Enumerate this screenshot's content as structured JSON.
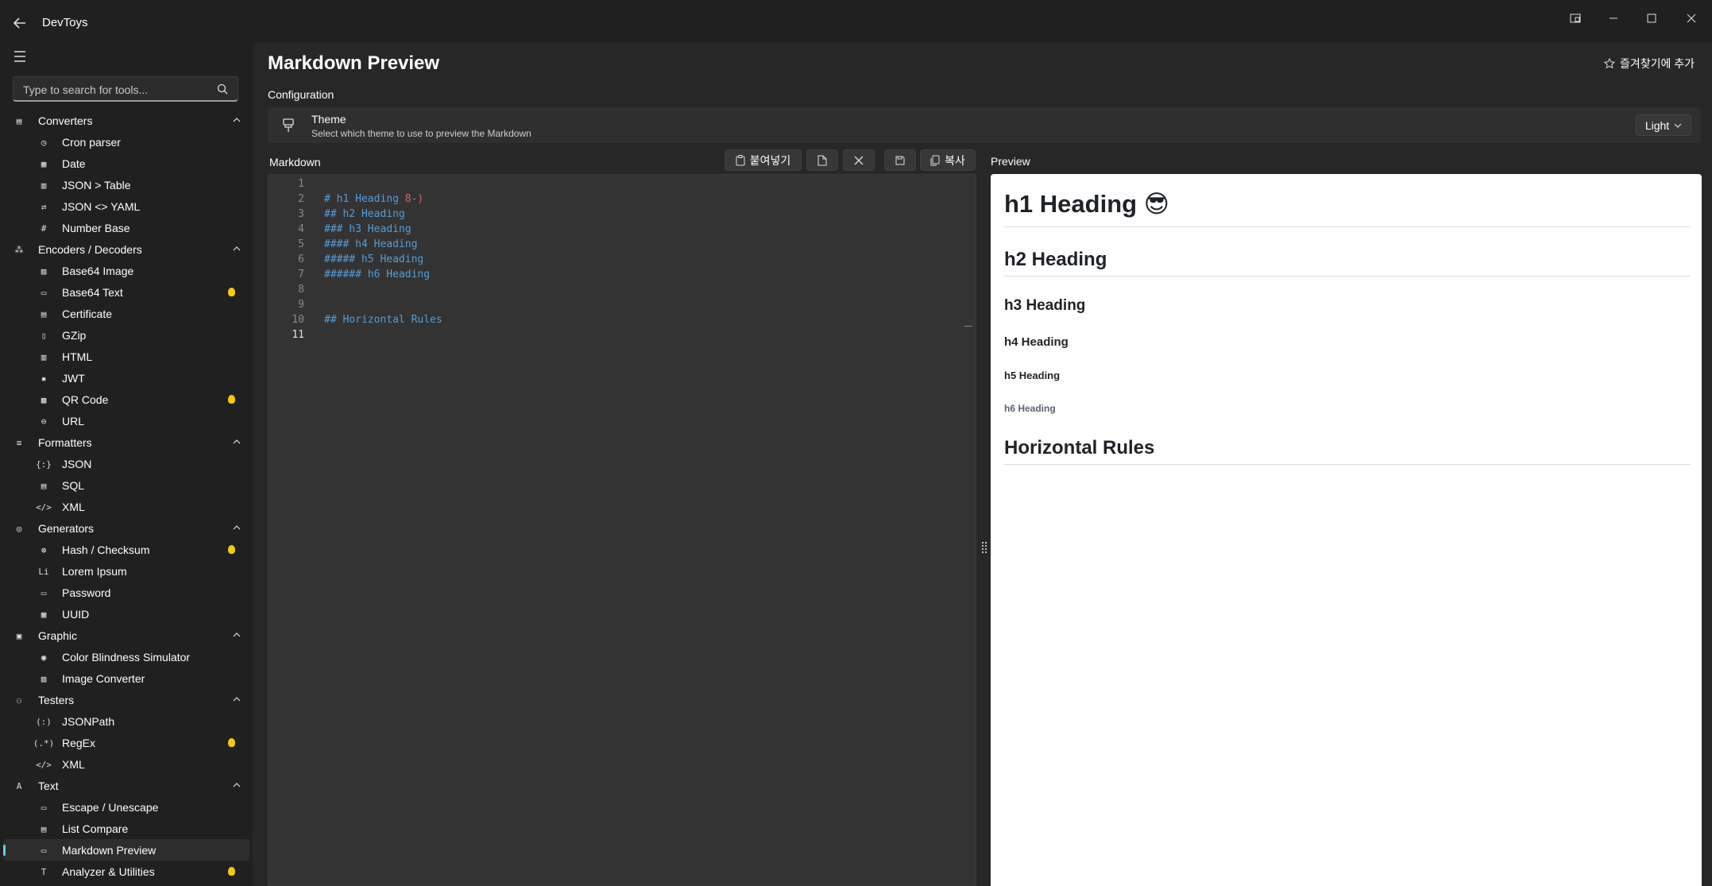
{
  "app": {
    "title": "DevToys"
  },
  "search": {
    "placeholder": "Type to search for tools..."
  },
  "sidebar": {
    "groups": [
      {
        "label": "Converters",
        "items": [
          "Cron parser",
          "Date",
          "JSON > Table",
          "JSON <> YAML",
          "Number Base"
        ]
      },
      {
        "label": "Encoders / Decoders",
        "items": [
          "Base64 Image",
          "Base64 Text",
          "Certificate",
          "GZip",
          "HTML",
          "JWT",
          "QR Code",
          "URL"
        ]
      },
      {
        "label": "Formatters",
        "items": [
          "JSON",
          "SQL",
          "XML"
        ]
      },
      {
        "label": "Generators",
        "items": [
          "Hash / Checksum",
          "Lorem Ipsum",
          "Password",
          "UUID"
        ]
      },
      {
        "label": "Graphic",
        "items": [
          "Color Blindness Simulator",
          "Image Converter"
        ]
      },
      {
        "label": "Testers",
        "items": [
          "JSONPath",
          "RegEx",
          "XML"
        ]
      },
      {
        "label": "Text",
        "items": [
          "Escape / Unescape",
          "List Compare",
          "Markdown Preview",
          "Analyzer & Utilities"
        ]
      }
    ],
    "bulb_icons": [
      "Base64 Text",
      "QR Code",
      "Hash / Checksum",
      "RegEx",
      "Analyzer & Utilities"
    ],
    "selected": "Markdown Preview"
  },
  "page": {
    "title": "Markdown Preview",
    "favorite_label": "즐겨찾기에 추가",
    "configuration_label": "Configuration"
  },
  "theme": {
    "title": "Theme",
    "subtitle": "Select which theme to use to preview the Markdown",
    "value": "Light"
  },
  "markdown": {
    "label": "Markdown",
    "paste_label": "붙여넣기",
    "copy_label": "복사",
    "lines": [
      "",
      "# h1 Heading 8-)",
      "## h2 Heading",
      "### h3 Heading",
      "#### h4 Heading",
      "##### h5 Heading",
      "###### h6 Heading",
      "",
      "",
      "## Horizontal Rules",
      ""
    ],
    "line_numbers": [
      "1",
      "2",
      "3",
      "4",
      "5",
      "6",
      "7",
      "8",
      "9",
      "10",
      "11"
    ],
    "current_line": 11
  },
  "preview": {
    "label": "Preview",
    "h1": "h1 Heading",
    "h1_emoji": "😎",
    "h2": "h2 Heading",
    "h3": "h3 Heading",
    "h4": "h4 Heading",
    "h5": "h5 Heading",
    "h6": "h6 Heading",
    "h2b": "Horizontal Rules"
  },
  "colors": {
    "accent": "#60cdff",
    "bulb": "#f2c811",
    "code_blue": "#569cd6",
    "code_red": "#d16969"
  }
}
